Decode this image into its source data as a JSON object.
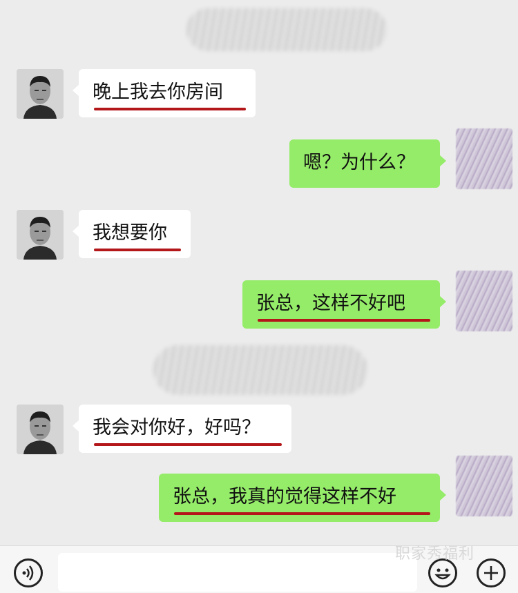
{
  "chat": {
    "messages": [
      {
        "side": "in",
        "text": "晚上我去你房间"
      },
      {
        "side": "out",
        "text": "嗯？为什么？"
      },
      {
        "side": "in",
        "text": "我想要你"
      },
      {
        "side": "out",
        "text": "张总，这样不好吧"
      },
      {
        "side": "in",
        "text": "我会对你好，好吗？"
      },
      {
        "side": "out",
        "text": "张总，我真的觉得这样不好"
      }
    ],
    "colors": {
      "background": "#ececec",
      "incoming_bubble": "#ffffff",
      "outgoing_bubble": "#95ec69",
      "underline": "#b3171a"
    }
  },
  "bottombar": {
    "voice_icon": "voice-icon",
    "emoji_icon": "emoji-icon",
    "plus_icon": "plus-icon"
  },
  "watermark": "职家秀福利"
}
